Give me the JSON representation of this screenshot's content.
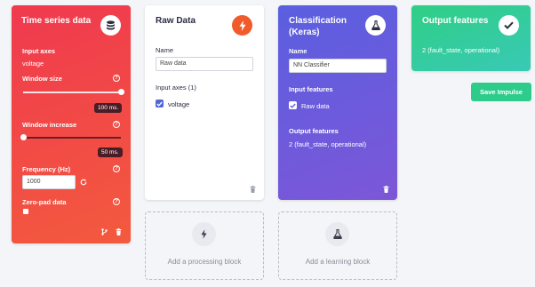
{
  "colors": {
    "time_series_gradient": [
      "#f0394f",
      "#f7653a"
    ],
    "classification_gradient": [
      "#5a5fe0",
      "#7c57d8"
    ],
    "output_gradient": [
      "#2fcf85",
      "#39c9b6"
    ],
    "raw_badge": "#f15a2b",
    "save_button": "#2ecc8a"
  },
  "time_series": {
    "title": "Time series data",
    "icon": "database-icon",
    "input_axes_label": "Input axes",
    "input_axes_value": "voltage",
    "window_size_label": "Window size",
    "window_size_value": "100 ms.",
    "window_size_fill": 1.0,
    "window_increase_label": "Window increase",
    "window_increase_value": "50 ms.",
    "window_increase_fill": 0.0,
    "frequency_label": "Frequency (Hz)",
    "frequency_value": "1000",
    "zero_pad_label": "Zero-pad data",
    "zero_pad_checked": false
  },
  "raw_data": {
    "title": "Raw Data",
    "icon": "lightning-icon",
    "name_label": "Name",
    "name_value": "Raw data",
    "input_axes_label": "Input axes (1)",
    "axis_item": "voltage",
    "axis_checked": true
  },
  "add_processing": {
    "label": "Add a processing block",
    "icon": "lightning-icon"
  },
  "classification": {
    "title_line1": "Classification",
    "title_line2": "(Keras)",
    "icon": "flask-icon",
    "name_label": "Name",
    "name_value": "NN Classifier",
    "input_features_label": "Input features",
    "input_feature_item": "Raw data",
    "input_feature_checked": true,
    "output_features_label": "Output features",
    "output_features_value": "2 (fault_state, operational)"
  },
  "add_learning": {
    "label": "Add a learning block",
    "icon": "flask-icon"
  },
  "output_features": {
    "title": "Output features",
    "icon": "checkmark-icon",
    "value": "2 (fault_state, operational)"
  },
  "save_button": {
    "label": "Save Impulse"
  }
}
